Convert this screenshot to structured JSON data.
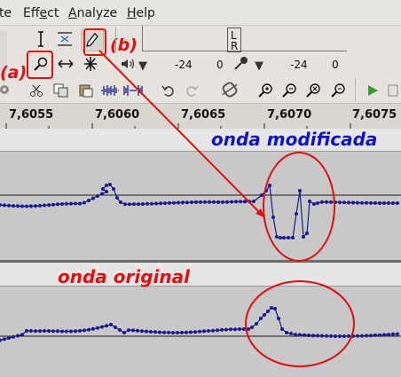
{
  "menu": {
    "items": [
      {
        "label_pre": "t",
        "label_ul": "",
        "label_post": "e"
      },
      {
        "label_pre": "Eff",
        "label_ul": "e",
        "label_post": "ct"
      },
      {
        "label_pre": "",
        "label_ul": "A",
        "label_post": "nalyze"
      },
      {
        "label_pre": "",
        "label_ul": "H",
        "label_post": "elp"
      }
    ]
  },
  "annotations": {
    "label_a": "(a)",
    "label_b": "(b)"
  },
  "meters": {
    "lr_label_l": "L",
    "lr_label_r": "R",
    "playback_db": "-24",
    "playback_zero": "0",
    "record_db": "-24",
    "record_zero": "0"
  },
  "ruler": {
    "ticks": [
      "7,6055",
      "7,6060",
      "7,6065",
      "7,6070",
      "7,6075"
    ]
  },
  "tracks": {
    "modified_label": "onda modificada",
    "original_label": "onda original"
  },
  "colors": {
    "annotation_red": "#e01010",
    "wave_blue": "#1a1a8c",
    "modified_label": "#1010c8",
    "original_label": "#e01010",
    "track_bg": "#c8c8c8",
    "track_gap": "#e6e6e6"
  },
  "icons": [
    "ibeam-icon",
    "envelope-icon",
    "pencil-icon",
    "zoom-icon",
    "timeshift-icon",
    "multi-tool-icon",
    "speaker-icon",
    "microphone-icon",
    "cut-icon",
    "copy-icon",
    "paste-icon",
    "trim-icon",
    "silence-icon",
    "undo-icon",
    "redo-icon",
    "sync-lock-icon",
    "zoom-in-icon",
    "zoom-out-icon",
    "fit-selection-icon",
    "fit-project-icon",
    "play-icon"
  ]
}
